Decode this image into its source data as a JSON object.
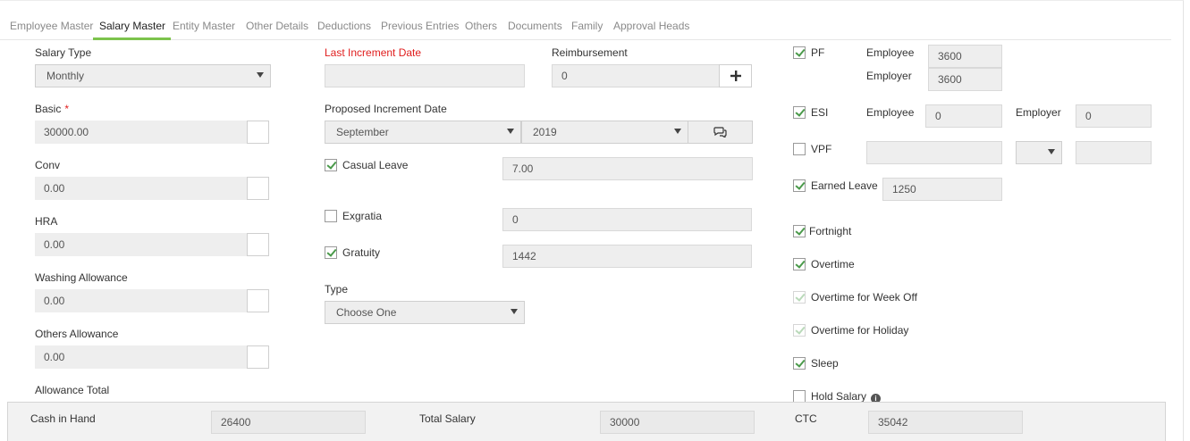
{
  "tabs": [
    {
      "label": "Employee Master"
    },
    {
      "label": "Salary Master"
    },
    {
      "label": "Entity Master"
    },
    {
      "label": "Other Details"
    },
    {
      "label": "Deductions"
    },
    {
      "label": "Previous Entries"
    },
    {
      "label": "Others"
    },
    {
      "label": "Documents"
    },
    {
      "label": "Family"
    },
    {
      "label": "Approval Heads"
    }
  ],
  "active_tab": "Salary Master",
  "left": {
    "salary_type_label": "Salary Type",
    "salary_type_value": "Monthly",
    "basic_label": "Basic",
    "basic_required": "*",
    "basic_value": "30000.00",
    "conv_label": "Conv",
    "conv_value": "0.00",
    "hra_label": "HRA",
    "hra_value": "0.00",
    "washing_label": "Washing Allowance",
    "washing_value": "0.00",
    "others_label": "Others Allowance",
    "others_value": "0.00",
    "allowance_total_label": "Allowance Total"
  },
  "middle": {
    "last_increment_label": "Last Increment Date",
    "last_increment_value": "",
    "reimbursement_label": "Reimbursement",
    "reimbursement_value": "0",
    "proposed_increment_label": "Proposed Increment Date",
    "month_value": "September",
    "year_value": "2019",
    "casual_leave_label": "Casual Leave",
    "casual_leave_checked": true,
    "casual_leave_value": "7.00",
    "exgratia_label": "Exgratia",
    "exgratia_checked": false,
    "exgratia_value": "0",
    "gratuity_label": "Gratuity",
    "gratuity_checked": true,
    "gratuity_value": "1442",
    "type_label": "Type",
    "type_value": "Choose One"
  },
  "right": {
    "pf_label": "PF",
    "pf_employee_label": "Employee",
    "pf_employee_value": "3600",
    "pf_employer_label": "Employer",
    "pf_employer_value": "3600",
    "esi_label": "ESI",
    "esi_employee_label": "Employee",
    "esi_employee_value": "0",
    "esi_employer_label": "Employer",
    "esi_employer_value": "0",
    "vpf_label": "VPF",
    "earned_leave_label": "Earned Leave",
    "earned_leave_value": "1250",
    "fortnight_label": "Fortnight",
    "overtime_label": "Overtime",
    "overtime_week_off_label": "Overtime for Week Off",
    "overtime_holiday_label": "Overtime for Holiday",
    "sleep_label": "Sleep",
    "hold_salary_label": "Hold Salary"
  },
  "footer": {
    "cash_in_hand_label": "Cash in Hand",
    "cash_in_hand_value": "26400",
    "total_salary_label": "Total Salary",
    "total_salary_value": "30000",
    "ctc_label": "CTC",
    "ctc_value": "35042"
  },
  "colors": {
    "accent_green": "#7cc34c",
    "required_red": "#e01e1e"
  }
}
